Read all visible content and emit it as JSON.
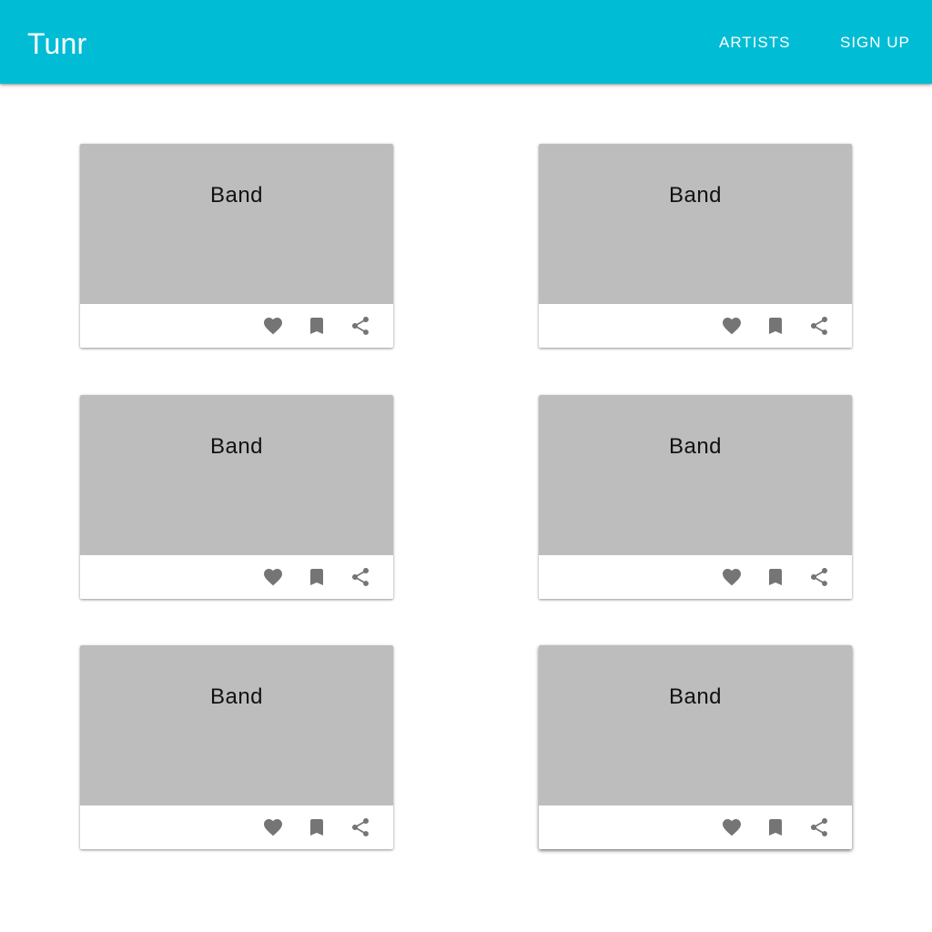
{
  "app_bar": {
    "title": "Tunr",
    "background": "#00bcd4",
    "nav": [
      {
        "label": "ARTISTS"
      },
      {
        "label": "SIGN UP"
      }
    ]
  },
  "cards": [
    {
      "title": "Band"
    },
    {
      "title": "Band"
    },
    {
      "title": "Band"
    },
    {
      "title": "Band"
    },
    {
      "title": "Band"
    },
    {
      "title": "Band"
    }
  ],
  "card_actions": {
    "icons": [
      "heart-icon",
      "bookmark-icon",
      "share-icon"
    ],
    "icon_color": "#757575"
  },
  "colors": {
    "media_placeholder": "#bdbdbd",
    "card_background": "#ffffff",
    "page_background": "#ffffff"
  }
}
